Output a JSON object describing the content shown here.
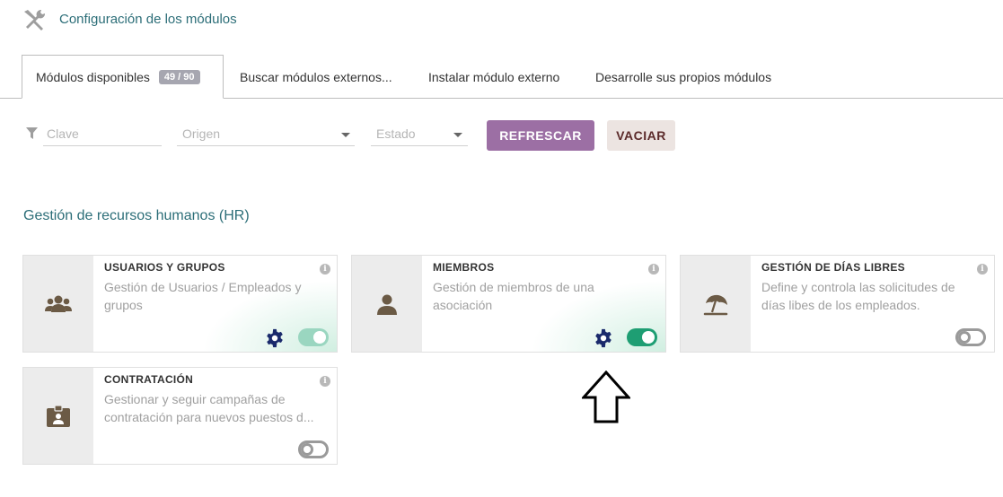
{
  "header": {
    "title": "Configuración de los módulos",
    "icon": "tools-icon"
  },
  "tabs": [
    {
      "label": "Módulos disponibles",
      "badge": "49 / 90",
      "active": true
    },
    {
      "label": "Buscar módulos externos...",
      "active": false
    },
    {
      "label": "Instalar módulo externo",
      "active": false
    },
    {
      "label": "Desarrolle sus propios módulos",
      "active": false
    }
  ],
  "filters": {
    "key_placeholder": "Clave",
    "origin_placeholder": "Origen",
    "state_placeholder": "Estado",
    "refresh_label": "REFRESCAR",
    "clear_label": "VACIAR"
  },
  "section": {
    "title": "Gestión de recursos humanos (HR)"
  },
  "modules": [
    {
      "title": "USUARIOS Y GRUPOS",
      "description": "Gestión de Usuarios / Empleados y grupos",
      "icon": "users-group-icon",
      "enabled": true,
      "has_settings": true
    },
    {
      "title": "MIEMBROS",
      "description": "Gestión de miembros de una asociación",
      "icon": "member-icon",
      "enabled": true,
      "has_settings": true
    },
    {
      "title": "GESTIÓN DE DÍAS LIBRES",
      "description": "Define y controla las solicitudes de días libes de los empleados.",
      "icon": "beach-umbrella-icon",
      "enabled": false,
      "has_settings": false
    },
    {
      "title": "CONTRATACIÓN",
      "description": "Gestionar y seguir campañas de contratación para nuevos puestos d...",
      "icon": "id-badge-icon",
      "enabled": false,
      "has_settings": false
    }
  ],
  "colors": {
    "accent": "#9c6fa4",
    "link": "#2c6e78",
    "toggle_on": "#1e9e73",
    "gear": "#1a2a6c",
    "icon_brown": "#6b5a45"
  }
}
